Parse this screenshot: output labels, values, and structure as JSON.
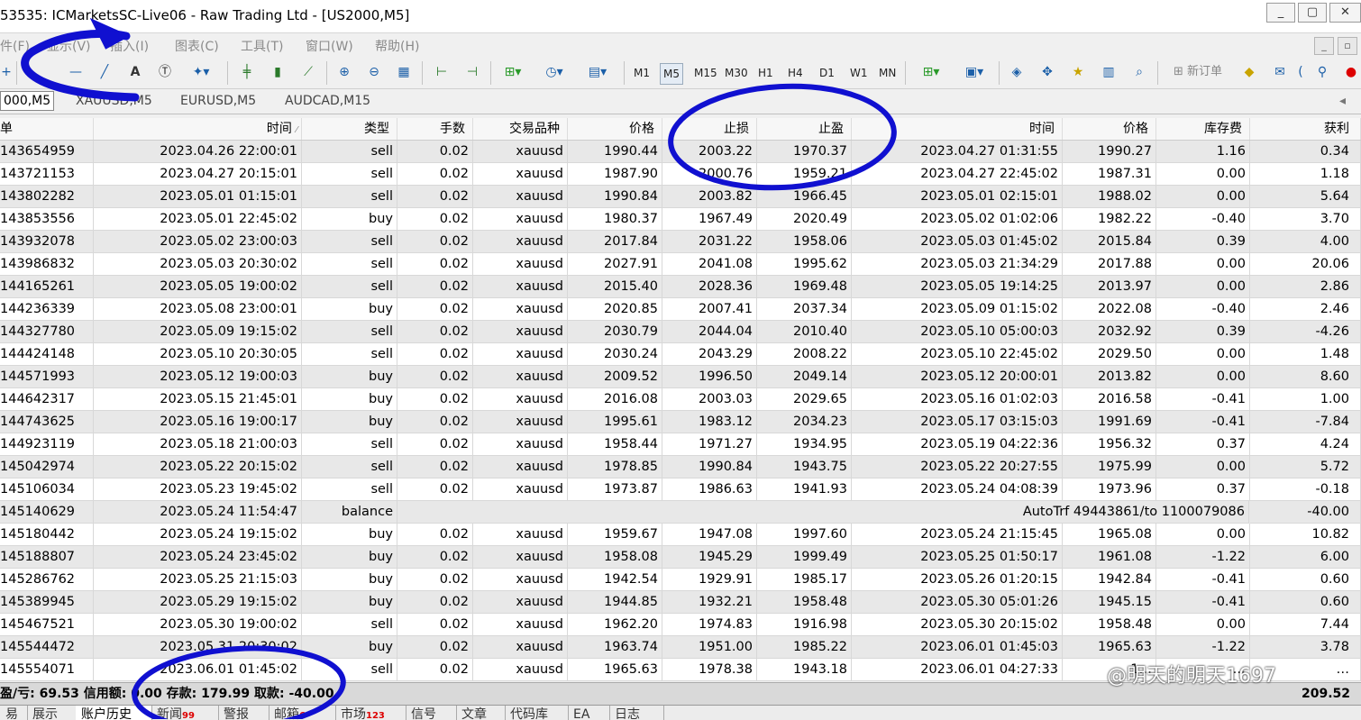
{
  "window": {
    "title": "53535: ICMarketsSC-Live06 - Raw Trading Ltd - [US2000,M5]",
    "buttons": [
      "_",
      "▢",
      "✕"
    ]
  },
  "menu": [
    "件(F)",
    "显示(V)",
    "插入(I)",
    "图表(C)",
    "工具(T)",
    "窗口(W)",
    "帮助(H)"
  ],
  "toolbar": {
    "timeframes": [
      "M1",
      "M5",
      "M15",
      "M30",
      "H1",
      "H4",
      "D1",
      "W1",
      "MN"
    ],
    "active_timeframe": "M5",
    "new_order": "新订单"
  },
  "chart_tabs": [
    "000,M5",
    "XAUUSD,M5",
    "EURUSD,M5",
    "AUDCAD,M15"
  ],
  "table": {
    "headers": [
      "单",
      "时间",
      "类型",
      "手数",
      "交易品种",
      "价格",
      "止损",
      "止盈",
      "时间",
      "价格",
      "库存费",
      "获利"
    ],
    "rows": [
      [
        "143654959",
        "2023.04.26 22:00:01",
        "sell",
        "0.02",
        "xauusd",
        "1990.44",
        "2003.22",
        "1970.37",
        "2023.04.27 01:31:55",
        "1990.27",
        "1.16",
        "0.34"
      ],
      [
        "143721153",
        "2023.04.27 20:15:01",
        "sell",
        "0.02",
        "xauusd",
        "1987.90",
        "2000.76",
        "1959.21",
        "2023.04.27 22:45:02",
        "1987.31",
        "0.00",
        "1.18"
      ],
      [
        "143802282",
        "2023.05.01 01:15:01",
        "sell",
        "0.02",
        "xauusd",
        "1990.84",
        "2003.82",
        "1966.45",
        "2023.05.01 02:15:01",
        "1988.02",
        "0.00",
        "5.64"
      ],
      [
        "143853556",
        "2023.05.01 22:45:02",
        "buy",
        "0.02",
        "xauusd",
        "1980.37",
        "1967.49",
        "2020.49",
        "2023.05.02 01:02:06",
        "1982.22",
        "-0.40",
        "3.70"
      ],
      [
        "143932078",
        "2023.05.02 23:00:03",
        "sell",
        "0.02",
        "xauusd",
        "2017.84",
        "2031.22",
        "1958.06",
        "2023.05.03 01:45:02",
        "2015.84",
        "0.39",
        "4.00"
      ],
      [
        "143986832",
        "2023.05.03 20:30:02",
        "sell",
        "0.02",
        "xauusd",
        "2027.91",
        "2041.08",
        "1995.62",
        "2023.05.03 21:34:29",
        "2017.88",
        "0.00",
        "20.06"
      ],
      [
        "144165261",
        "2023.05.05 19:00:02",
        "sell",
        "0.02",
        "xauusd",
        "2015.40",
        "2028.36",
        "1969.48",
        "2023.05.05 19:14:25",
        "2013.97",
        "0.00",
        "2.86"
      ],
      [
        "144236339",
        "2023.05.08 23:00:01",
        "buy",
        "0.02",
        "xauusd",
        "2020.85",
        "2007.41",
        "2037.34",
        "2023.05.09 01:15:02",
        "2022.08",
        "-0.40",
        "2.46"
      ],
      [
        "144327780",
        "2023.05.09 19:15:02",
        "sell",
        "0.02",
        "xauusd",
        "2030.79",
        "2044.04",
        "2010.40",
        "2023.05.10 05:00:03",
        "2032.92",
        "0.39",
        "-4.26"
      ],
      [
        "144424148",
        "2023.05.10 20:30:05",
        "sell",
        "0.02",
        "xauusd",
        "2030.24",
        "2043.29",
        "2008.22",
        "2023.05.10 22:45:02",
        "2029.50",
        "0.00",
        "1.48"
      ],
      [
        "144571993",
        "2023.05.12 19:00:03",
        "buy",
        "0.02",
        "xauusd",
        "2009.52",
        "1996.50",
        "2049.14",
        "2023.05.12 20:00:01",
        "2013.82",
        "0.00",
        "8.60"
      ],
      [
        "144642317",
        "2023.05.15 21:45:01",
        "buy",
        "0.02",
        "xauusd",
        "2016.08",
        "2003.03",
        "2029.65",
        "2023.05.16 01:02:03",
        "2016.58",
        "-0.41",
        "1.00"
      ],
      [
        "144743625",
        "2023.05.16 19:00:17",
        "buy",
        "0.02",
        "xauusd",
        "1995.61",
        "1983.12",
        "2034.23",
        "2023.05.17 03:15:03",
        "1991.69",
        "-0.41",
        "-7.84"
      ],
      [
        "144923119",
        "2023.05.18 21:00:03",
        "sell",
        "0.02",
        "xauusd",
        "1958.44",
        "1971.27",
        "1934.95",
        "2023.05.19 04:22:36",
        "1956.32",
        "0.37",
        "4.24"
      ],
      [
        "145042974",
        "2023.05.22 20:15:02",
        "sell",
        "0.02",
        "xauusd",
        "1978.85",
        "1990.84",
        "1943.75",
        "2023.05.22 20:27:55",
        "1975.99",
        "0.00",
        "5.72"
      ],
      [
        "145106034",
        "2023.05.23 19:45:02",
        "sell",
        "0.02",
        "xauusd",
        "1973.87",
        "1986.63",
        "1941.93",
        "2023.05.24 04:08:39",
        "1973.96",
        "0.37",
        "-0.18"
      ],
      [
        "145140629",
        "2023.05.24 11:54:47",
        "balance",
        "",
        "",
        "",
        "",
        "",
        "AutoTrf 49443861/to 1100079086",
        "",
        "",
        "-40.00"
      ],
      [
        "145180442",
        "2023.05.24 19:15:02",
        "buy",
        "0.02",
        "xauusd",
        "1959.67",
        "1947.08",
        "1997.60",
        "2023.05.24 21:15:45",
        "1965.08",
        "0.00",
        "10.82"
      ],
      [
        "145188807",
        "2023.05.24 23:45:02",
        "buy",
        "0.02",
        "xauusd",
        "1958.08",
        "1945.29",
        "1999.49",
        "2023.05.25 01:50:17",
        "1961.08",
        "-1.22",
        "6.00"
      ],
      [
        "145286762",
        "2023.05.25 21:15:03",
        "buy",
        "0.02",
        "xauusd",
        "1942.54",
        "1929.91",
        "1985.17",
        "2023.05.26 01:20:15",
        "1942.84",
        "-0.41",
        "0.60"
      ],
      [
        "145389945",
        "2023.05.29 19:15:02",
        "buy",
        "0.02",
        "xauusd",
        "1944.85",
        "1932.21",
        "1958.48",
        "2023.05.30 05:01:26",
        "1945.15",
        "-0.41",
        "0.60"
      ],
      [
        "145467521",
        "2023.05.30 19:00:02",
        "sell",
        "0.02",
        "xauusd",
        "1962.20",
        "1974.83",
        "1916.98",
        "2023.05.30 20:15:02",
        "1958.48",
        "0.00",
        "7.44"
      ],
      [
        "145544472",
        "2023.05.31 20:30:02",
        "buy",
        "0.02",
        "xauusd",
        "1963.74",
        "1951.00",
        "1985.22",
        "2023.06.01 01:45:03",
        "1965.63",
        "-1.22",
        "3.78"
      ],
      [
        "145554071",
        "2023.06.01 01:45:02",
        "sell",
        "0.02",
        "xauusd",
        "1965.63",
        "1978.38",
        "1943.18",
        "2023.06.01 04:27:33",
        "1…",
        "…",
        "…"
      ]
    ]
  },
  "summary": {
    "text": "盈/亏: 69.53  信用额: 0.00  存款: 179.99  取款: -40.00",
    "total": "209.52"
  },
  "bottom_tabs": [
    {
      "label": "易",
      "badge": ""
    },
    {
      "label": "展示",
      "badge": ""
    },
    {
      "label": "账户历史",
      "badge": ""
    },
    {
      "label": "新闻",
      "badge": "99"
    },
    {
      "label": "警报",
      "badge": ""
    },
    {
      "label": "邮箱",
      "badge": "6"
    },
    {
      "label": "市场",
      "badge": "123"
    },
    {
      "label": "信号",
      "badge": ""
    },
    {
      "label": "文章",
      "badge": ""
    },
    {
      "label": "代码库",
      "badge": ""
    },
    {
      "label": "EA",
      "badge": ""
    },
    {
      "label": "日志",
      "badge": ""
    }
  ],
  "active_bottom_tab": "账户历史",
  "watermark": "@明天的明天1697",
  "annotation_color": "#1010d0"
}
